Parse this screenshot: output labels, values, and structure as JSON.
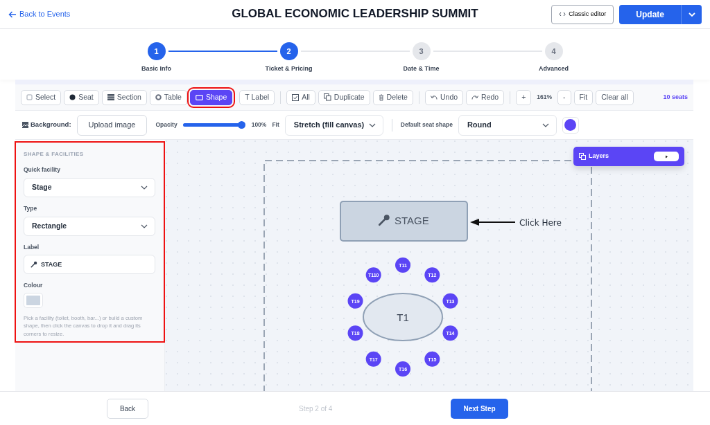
{
  "header": {
    "back_link": "Back to Events",
    "title": "GLOBAL ECONOMIC LEADERSHIP SUMMIT",
    "classic_editor": "Classic editor",
    "update": "Update"
  },
  "steps": [
    {
      "number": "1",
      "label": "Basic Info",
      "active": true
    },
    {
      "number": "2",
      "label": "Ticket & Pricing",
      "active": true
    },
    {
      "number": "3",
      "label": "Date & Time",
      "active": false
    },
    {
      "number": "4",
      "label": "Advanced",
      "active": false
    }
  ],
  "toolbar": {
    "tools": [
      {
        "label": "Select",
        "selected": false,
        "highlighted": false
      },
      {
        "label": "Seat",
        "selected": false,
        "highlighted": false
      },
      {
        "label": "Section",
        "selected": false,
        "highlighted": false
      },
      {
        "label": "Table",
        "selected": false,
        "highlighted": false
      },
      {
        "label": "Shape",
        "selected": true,
        "highlighted": true
      },
      {
        "label": "T Label",
        "selected": false,
        "highlighted": false
      }
    ],
    "actions": [
      "All",
      "Duplicate",
      "Delete"
    ],
    "history": [
      "Undo",
      "Redo"
    ],
    "zoom_in": "+",
    "zoom_level": "161%",
    "zoom_out": "-",
    "fit": "Fit",
    "clear": "Clear all",
    "seat_count": "10 seats"
  },
  "background_bar": {
    "label": "Background:",
    "upload": "Upload image",
    "opacity_label": "Opacity",
    "opacity": {
      "level": 1.0,
      "reading": "100%"
    },
    "fit_label": "Fit",
    "fit_value": "Stretch (fill canvas)",
    "seat_shape_label": "Default seat shape",
    "seat_shape": "Round"
  },
  "panel": {
    "heading": "SHAPE & FACILITIES",
    "highlighted": true,
    "quick_facility": {
      "label": "Quick facility",
      "value": "Stage"
    },
    "type": {
      "label": "Type",
      "value": "Rectangle"
    },
    "shape_label": {
      "label": "Label",
      "value": "STAGE"
    },
    "colour": {
      "label": "Colour",
      "color": "#cbd5e1"
    },
    "help": "Pick a facility (toilet, booth, bar...) or build a custom shape, then click the canvas to drop it and drag its corners to resize."
  },
  "canvas": {
    "layers": "Layers",
    "stage": "STAGE",
    "table": "T1",
    "seats": [
      "T11",
      "T12",
      "T13",
      "T14",
      "T15",
      "T16",
      "T17",
      "T18",
      "T19",
      "T110"
    ],
    "annotation": "Click Here"
  },
  "footer": {
    "back": "Back",
    "step": "Step 2 of 4",
    "next": "Next Step"
  }
}
